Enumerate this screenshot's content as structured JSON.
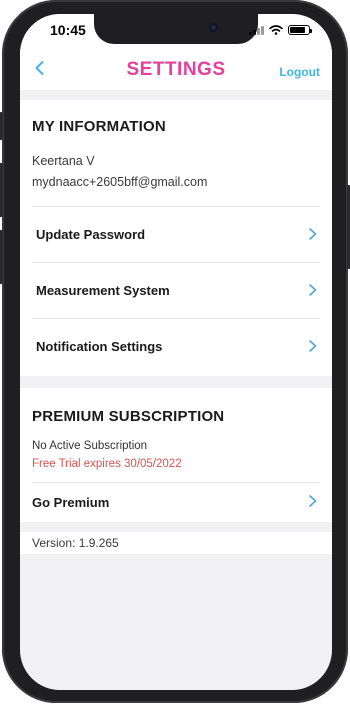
{
  "status_bar": {
    "time": "10:45"
  },
  "header": {
    "title": "SETTINGS",
    "logout_label": "Logout"
  },
  "my_information": {
    "heading": "MY INFORMATION",
    "name": "Keertana V",
    "email": "mydnaacc+2605bff@gmail.com",
    "items": [
      {
        "label": "Update Password"
      },
      {
        "label": "Measurement System"
      },
      {
        "label": "Notification Settings"
      }
    ]
  },
  "premium": {
    "heading": "PREMIUM SUBSCRIPTION",
    "status": "No Active Subscription",
    "trial": "Free Trial expires 30/05/2022",
    "go_premium_label": "Go Premium"
  },
  "footer": {
    "version": "Version: 1.9.265"
  },
  "colors": {
    "title_pink": "#e6409a",
    "link_blue": "#42b6e0",
    "trial_red": "#d9534f",
    "chevron_blue": "#4aa8d8"
  },
  "icons": {
    "back": "chevron-left-icon",
    "row": "chevron-right-icon"
  }
}
